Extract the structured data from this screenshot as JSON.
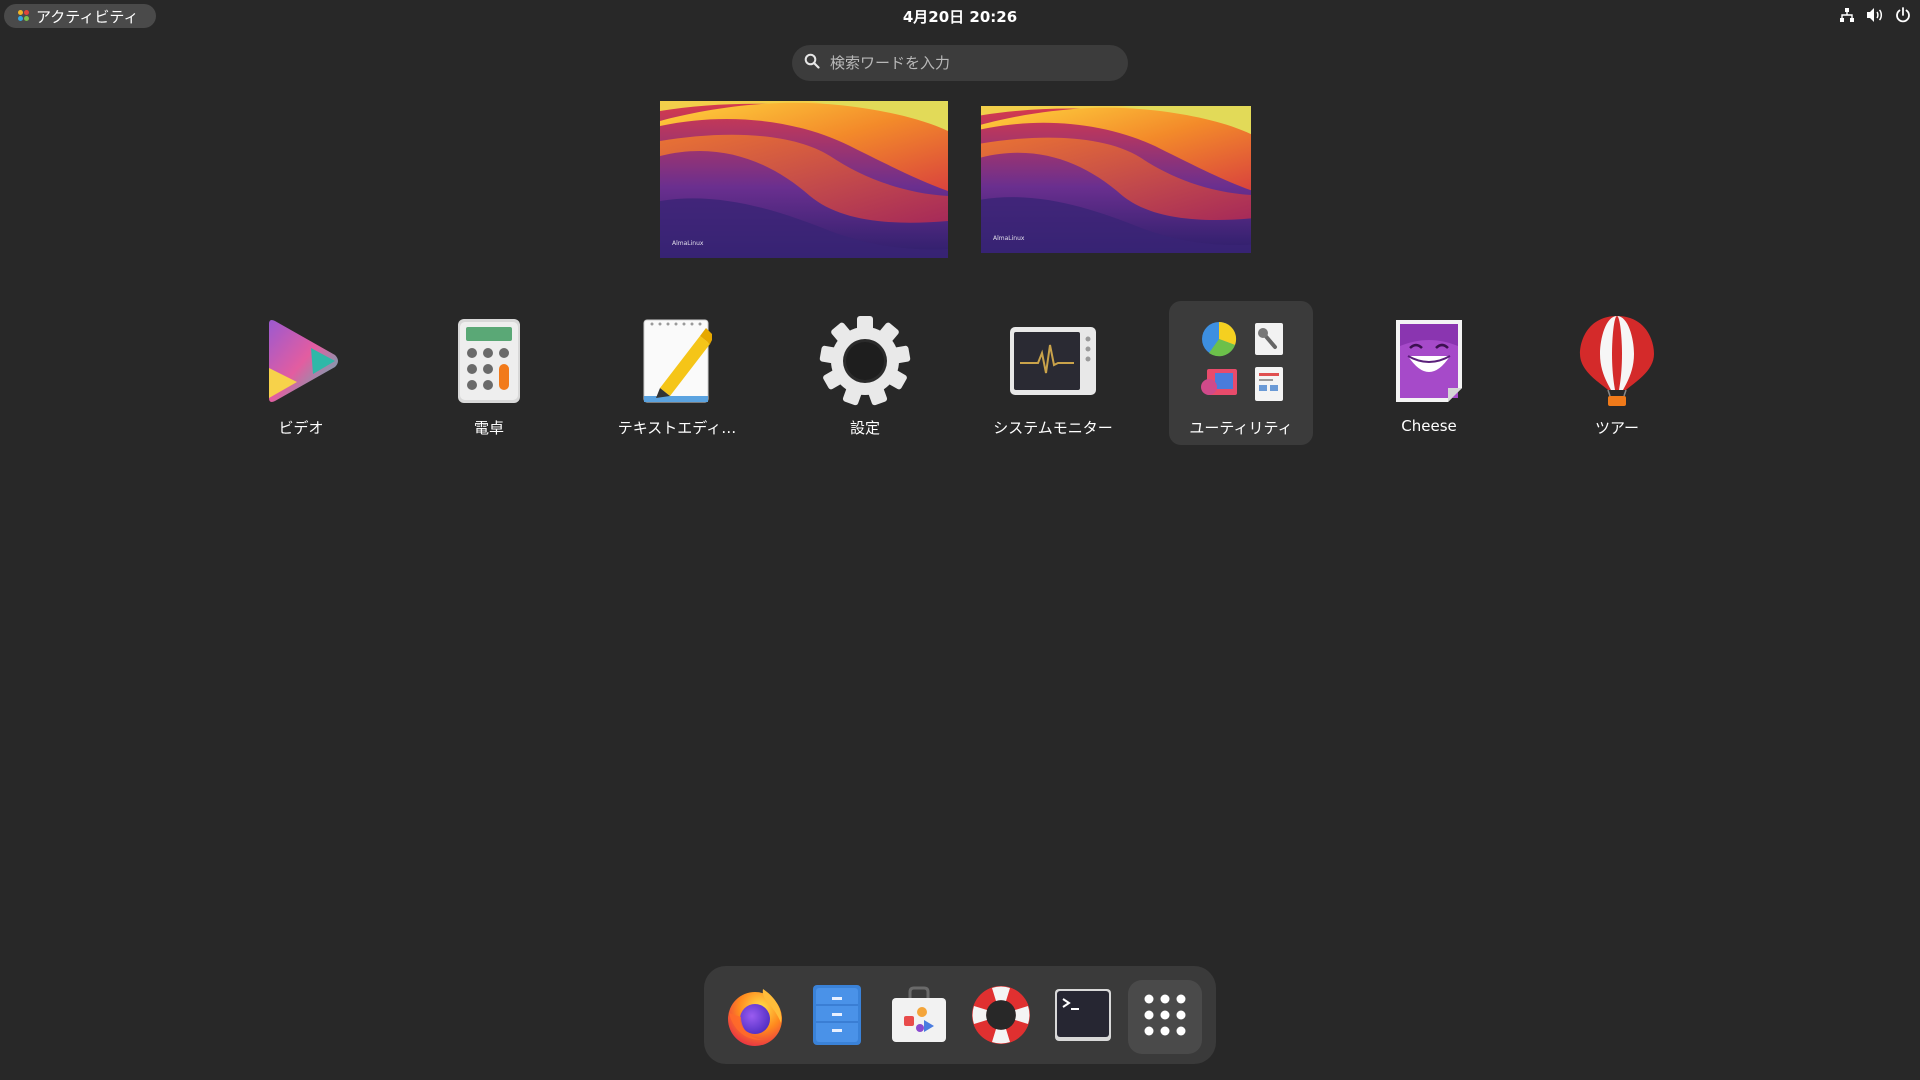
{
  "topbar": {
    "activities_label": "アクティビティ",
    "clock": "4月20日  20:26",
    "tray_icons": [
      "network-icon",
      "volume-icon",
      "power-icon"
    ]
  },
  "search": {
    "placeholder": "検索ワードを入力"
  },
  "workspaces": [
    {
      "brand": "AlmaLinux"
    },
    {
      "brand": "AlmaLinux"
    }
  ],
  "apps": [
    {
      "label": "ビデオ",
      "icon": "video-icon"
    },
    {
      "label": "電卓",
      "icon": "calculator-icon"
    },
    {
      "label": "テキストエディ…",
      "icon": "text-editor-icon"
    },
    {
      "label": "設定",
      "icon": "settings-icon"
    },
    {
      "label": "システムモニター",
      "icon": "system-monitor-icon"
    },
    {
      "label": "ユーティリティ",
      "icon": "utilities-folder-icon"
    },
    {
      "label": "Cheese",
      "icon": "cheese-icon"
    },
    {
      "label": "ツアー",
      "icon": "tour-icon"
    }
  ],
  "dock": [
    {
      "name": "firefox",
      "icon": "firefox-icon"
    },
    {
      "name": "files",
      "icon": "files-icon"
    },
    {
      "name": "software",
      "icon": "software-icon"
    },
    {
      "name": "help",
      "icon": "help-icon"
    },
    {
      "name": "terminal",
      "icon": "terminal-icon"
    },
    {
      "name": "show-apps",
      "icon": "app-grid-icon"
    }
  ],
  "colors": {
    "background": "#282828",
    "panel": "#3a3a3a",
    "folder_bg": "#3b3b3b"
  }
}
